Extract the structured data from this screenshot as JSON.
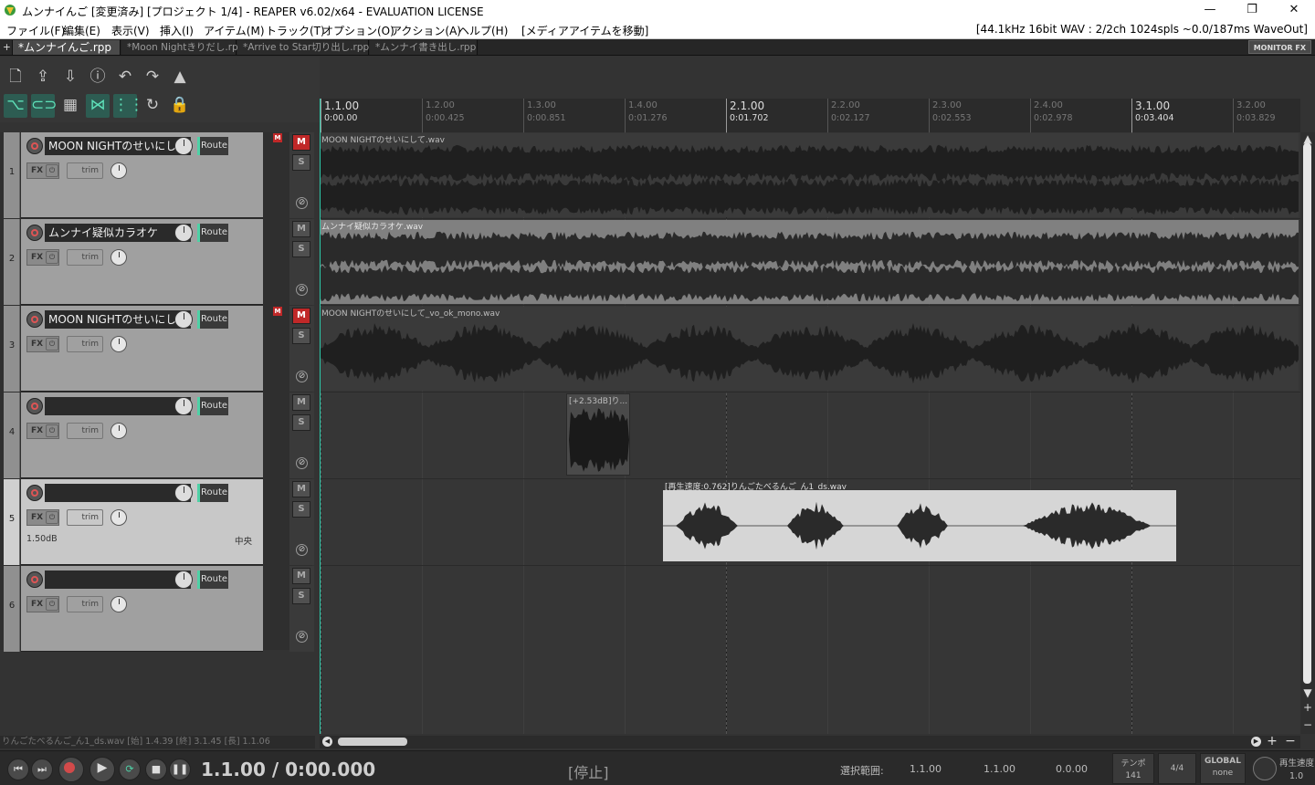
{
  "window": {
    "title": "ムンナイんご [変更済み] [プロジェクト 1/4] - REAPER v6.02/x64 - EVALUATION LICENSE",
    "min": "—",
    "max": "❐",
    "close": "✕"
  },
  "menu": {
    "items": [
      "ファイル(F)",
      "編集(E)",
      "表示(V)",
      "挿入(I)",
      "アイテム(M)",
      "トラック(T)",
      "オプション(O)",
      "アクション(A)",
      "ヘルプ(H)",
      "[メディアアイテムを移動]"
    ],
    "status": "[44.1kHz 16bit WAV : 2/2ch 1024spls ~0.0/187ms WaveOut]"
  },
  "tabs": {
    "items": [
      "*ムンナイんご.rpp",
      "*Moon Nightきりだし.rpp",
      "*Arrive to Star切り出し.rpp",
      "*ムンナイ書き出し.rpp"
    ],
    "active": 0,
    "plus": "+",
    "monitor_fx": "MONITOR FX"
  },
  "toolbar": {
    "icons": [
      "new-project-icon",
      "save-icon",
      "render-icon",
      "info-icon",
      "undo-icon",
      "redo-icon",
      "metronome-icon",
      "ripple-edit-icon",
      "grouping-icon",
      "snap-grid-icon",
      "auto-crossfade-icon",
      "grid-lines-icon",
      "repeat-icon",
      "lock-icon"
    ]
  },
  "tracks": [
    {
      "num": "1",
      "name": "MOON NIGHTのせいにして",
      "muted": true,
      "mflag": true,
      "vol": "",
      "pan": "",
      "item_label": "MOON NIGHTのせいにして.wav"
    },
    {
      "num": "2",
      "name": "ムンナイ疑似カラオケ",
      "muted": false,
      "mflag": false,
      "vol": "",
      "pan": "",
      "item_label": "ムンナイ疑似カラオケ.wav"
    },
    {
      "num": "3",
      "name": "MOON NIGHTのせいにして_",
      "muted": true,
      "mflag": true,
      "vol": "",
      "pan": "",
      "item_label": "MOON NIGHTのせいにして_vo_ok_mono.wav"
    },
    {
      "num": "4",
      "name": "",
      "muted": false,
      "mflag": false,
      "vol": "",
      "pan": "",
      "item_label": "[+2.53dB]り..."
    },
    {
      "num": "5",
      "name": "",
      "muted": false,
      "mflag": false,
      "vol": "1.50dB",
      "pan": "中央",
      "item_label": "[再生速度:0.762]りんごたべるんご_ん1_ds.wav",
      "selected": true
    },
    {
      "num": "6",
      "name": "",
      "muted": false,
      "mflag": false,
      "vol": "",
      "pan": "",
      "item_label": ""
    }
  ],
  "track_labels": {
    "route": "Route",
    "fx": "FX",
    "trim": "trim",
    "mute": "M",
    "solo": "S",
    "phase": "⊘"
  },
  "ruler": [
    {
      "bar": "1.1.00",
      "time": "0:00.00",
      "major": true
    },
    {
      "bar": "1.2.00",
      "time": "0:00.425",
      "major": false
    },
    {
      "bar": "1.3.00",
      "time": "0:00.851",
      "major": false
    },
    {
      "bar": "1.4.00",
      "time": "0:01.276",
      "major": false
    },
    {
      "bar": "2.1.00",
      "time": "0:01.702",
      "major": true
    },
    {
      "bar": "2.2.00",
      "time": "0:02.127",
      "major": false
    },
    {
      "bar": "2.3.00",
      "time": "0:02.553",
      "major": false
    },
    {
      "bar": "2.4.00",
      "time": "0:02.978",
      "major": false
    },
    {
      "bar": "3.1.00",
      "time": "0:03.404",
      "major": true
    },
    {
      "bar": "3.2.00",
      "time": "0:03.829",
      "major": false
    }
  ],
  "info_line": "りんごたべるんご_ん1_ds.wav [始] 1.4.39 [終] 3.1.45 [長] 1.1.06",
  "transport": {
    "time": "1.1.00 / 0:00.000",
    "status": "[停止]",
    "selection_label": "選択範囲:",
    "sel_start": "1.1.00",
    "sel_end": "1.1.00",
    "sel_len": "0.0.00",
    "tempo_label": "テンポ",
    "tempo": "141",
    "timesig": "4/4",
    "global_label": "GLOBAL",
    "global_value": "none",
    "playrate_label": "再生速度",
    "playrate": "1.0"
  },
  "colors": {
    "accent": "#4fd1a6",
    "mute_on": "#c02828",
    "cursor": "#2cc9a9"
  }
}
